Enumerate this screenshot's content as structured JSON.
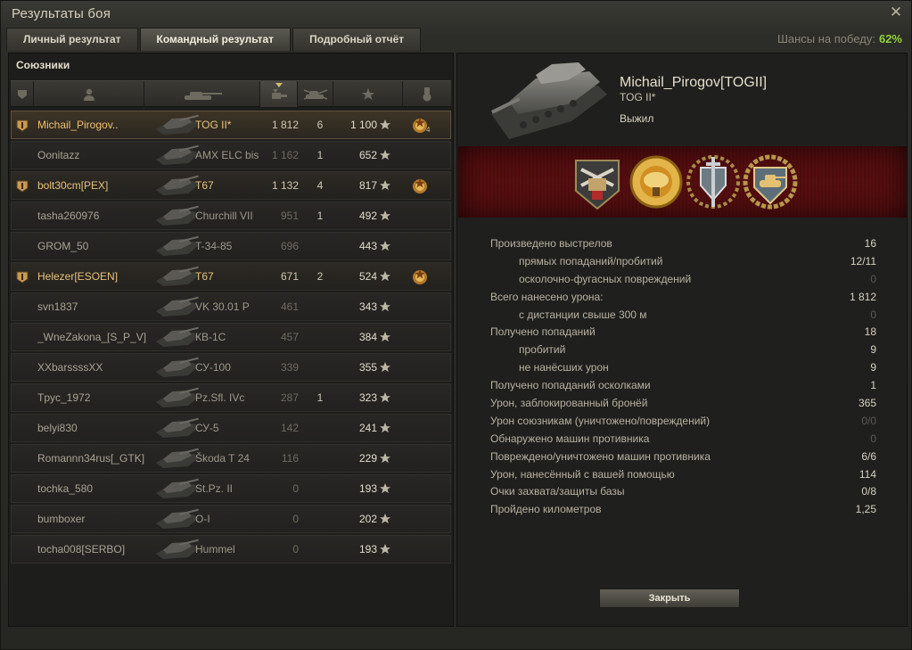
{
  "window": {
    "title": "Результаты боя"
  },
  "tabs": [
    {
      "label": "Личный результат",
      "active": false
    },
    {
      "label": "Командный результат",
      "active": true
    },
    {
      "label": "Подробный отчёт",
      "active": false
    }
  ],
  "win_chance": {
    "label": "Шансы на победу:",
    "value": "62%"
  },
  "allies": {
    "title": "Союзники",
    "columns": [
      "squad-icon",
      "player-icon",
      "tank-icon",
      "damage-icon",
      "frags-icon",
      "xp-icon",
      "medal-icon"
    ],
    "rows": [
      {
        "name": "Michail_Pirogov..",
        "vehicle": "TOG II*",
        "damage": "1 812",
        "kills": "6",
        "xp": "1 100",
        "squad": true,
        "self": true,
        "medal": true,
        "medal_count": "4"
      },
      {
        "name": "Oonitazz",
        "vehicle": "AMX ELC bis",
        "damage": "1 162",
        "kills": "1",
        "xp": "652",
        "squad": false,
        "self": false,
        "medal": false
      },
      {
        "name": "bolt30cm[PEX]",
        "vehicle": "T67",
        "damage": "1 132",
        "kills": "4",
        "xp": "817",
        "squad": true,
        "self": false,
        "medal": true
      },
      {
        "name": "tasha260976",
        "vehicle": "Churchill VII",
        "damage": "951",
        "kills": "1",
        "xp": "492",
        "squad": false,
        "self": false,
        "medal": false
      },
      {
        "name": "GROM_50",
        "vehicle": "T-34-85",
        "damage": "696",
        "kills": "",
        "xp": "443",
        "squad": false,
        "self": false,
        "medal": false
      },
      {
        "name": "Helezer[ESOEN]",
        "vehicle": "T67",
        "damage": "671",
        "kills": "2",
        "xp": "524",
        "squad": true,
        "self": false,
        "medal": true
      },
      {
        "name": "svn1837",
        "vehicle": "VK 30.01 P",
        "damage": "461",
        "kills": "",
        "xp": "343",
        "squad": false,
        "self": false,
        "medal": false
      },
      {
        "name": "_WneZakona_[S_P_V]",
        "vehicle": "КВ-1С",
        "damage": "457",
        "kills": "",
        "xp": "384",
        "squad": false,
        "self": false,
        "medal": false
      },
      {
        "name": "XXbarssssXX",
        "vehicle": "СУ-100",
        "damage": "339",
        "kills": "",
        "xp": "355",
        "squad": false,
        "self": false,
        "medal": false
      },
      {
        "name": "Tpyc_1972",
        "vehicle": "Pz.Sfl. IVc",
        "damage": "287",
        "kills": "1",
        "xp": "323",
        "squad": false,
        "self": false,
        "medal": false
      },
      {
        "name": "belyi830",
        "vehicle": "СУ-5",
        "damage": "142",
        "kills": "",
        "xp": "241",
        "squad": false,
        "self": false,
        "medal": false
      },
      {
        "name": "Romannn34rus[_GTK]",
        "vehicle": "Škoda T 24",
        "damage": "116",
        "kills": "",
        "xp": "229",
        "squad": false,
        "self": false,
        "medal": false
      },
      {
        "name": "tochka_580",
        "vehicle": "St.Pz. II",
        "damage": "0",
        "kills": "",
        "xp": "193",
        "squad": false,
        "self": false,
        "medal": false
      },
      {
        "name": "bumboxer",
        "vehicle": "O-I",
        "damage": "0",
        "kills": "",
        "xp": "202",
        "squad": false,
        "self": false,
        "medal": false
      },
      {
        "name": "tocha008[SERBO]",
        "vehicle": "Hummel",
        "damage": "0",
        "kills": "",
        "xp": "193",
        "squad": false,
        "self": false,
        "medal": false
      }
    ]
  },
  "player": {
    "name": "Michail_Pirogov[TOGII]",
    "vehicle": "TOG II*",
    "status": "Выжил",
    "achievements": [
      "raseiniai-icon",
      "warrior-icon",
      "defender-icon",
      "top-gun-icon"
    ]
  },
  "stats": [
    {
      "label": "Произведено выстрелов",
      "value": "16",
      "sub": false,
      "dim": false
    },
    {
      "label": "прямых попаданий/пробитий",
      "value": "12/11",
      "sub": true,
      "dim": false
    },
    {
      "label": "осколочно-фугасных повреждений",
      "value": "0",
      "sub": true,
      "dim": true
    },
    {
      "label": "Всего нанесено урона:",
      "value": "1 812",
      "sub": false,
      "dim": false
    },
    {
      "label": "с дистанции свыше 300 м",
      "value": "0",
      "sub": true,
      "dim": true
    },
    {
      "label": "Получено попаданий",
      "value": "18",
      "sub": false,
      "dim": false
    },
    {
      "label": "пробитий",
      "value": "9",
      "sub": true,
      "dim": false
    },
    {
      "label": "не нанёсших урон",
      "value": "9",
      "sub": true,
      "dim": false
    },
    {
      "label": "Получено попаданий осколками",
      "value": "1",
      "sub": false,
      "dim": false
    },
    {
      "label": "Урон, заблокированный бронёй",
      "value": "365",
      "sub": false,
      "dim": false
    },
    {
      "label": "Урон союзникам (уничтожено/повреждений)",
      "value": "0/0",
      "sub": false,
      "dim": true
    },
    {
      "label": "Обнаружено машин противника",
      "value": "0",
      "sub": false,
      "dim": true
    },
    {
      "label": "Повреждено/уничтожено машин противника",
      "value": "6/6",
      "sub": false,
      "dim": false
    },
    {
      "label": "Урон, нанесённый с вашей помощью",
      "value": "114",
      "sub": false,
      "dim": false
    },
    {
      "label": "Очки захвата/защиты базы",
      "value": "0/8",
      "sub": false,
      "dim": false
    },
    {
      "label": "Пройдено километров",
      "value": "1,25",
      "sub": false,
      "dim": false
    }
  ],
  "buttons": {
    "close_label": "Закрыть"
  },
  "colors": {
    "accent": "#f0c069",
    "win": "#8dd43a",
    "banner": "#4a0c0d"
  }
}
